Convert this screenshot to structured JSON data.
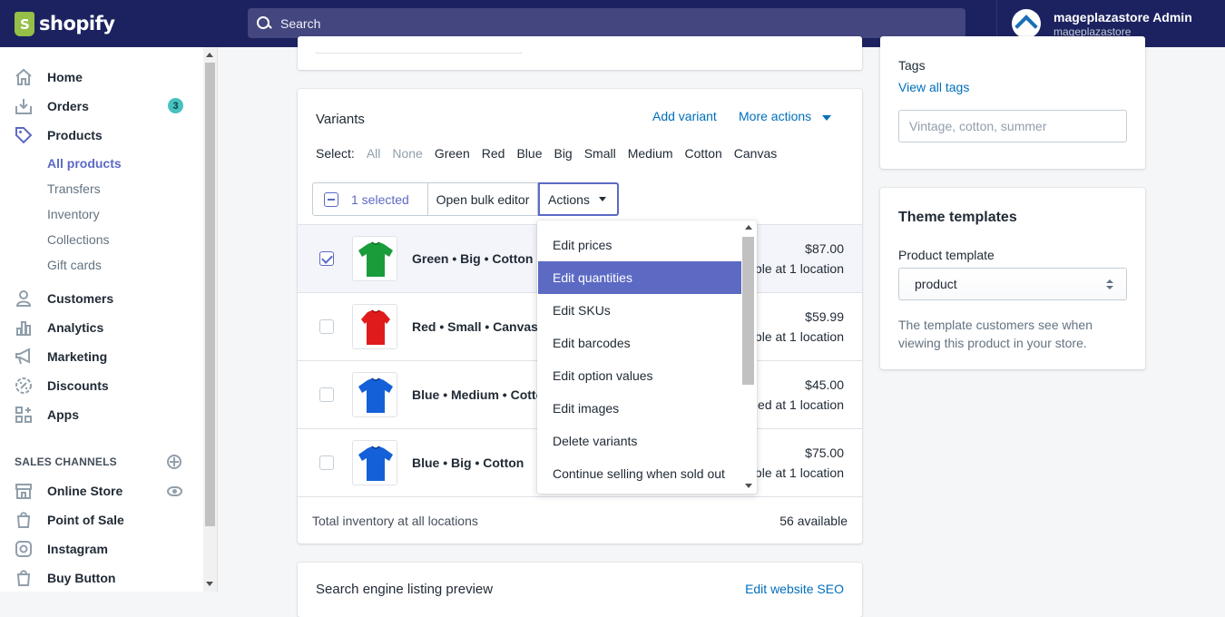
{
  "brand": {
    "name": "shopify",
    "color": "#95bf47",
    "topbar_color": "#1c2260"
  },
  "search": {
    "placeholder": "Search"
  },
  "user": {
    "name": "mageplazastore Admin",
    "store": "mageplazastore"
  },
  "sidebar": {
    "items": [
      {
        "label": "Home",
        "icon": "home-icon"
      },
      {
        "label": "Orders",
        "icon": "orders-icon",
        "badge": "3"
      },
      {
        "label": "Products",
        "icon": "tag-icon"
      },
      {
        "label": "Customers",
        "icon": "customer-icon"
      },
      {
        "label": "Analytics",
        "icon": "analytics-icon"
      },
      {
        "label": "Marketing",
        "icon": "megaphone-icon"
      },
      {
        "label": "Discounts",
        "icon": "discount-icon"
      },
      {
        "label": "Apps",
        "icon": "apps-icon"
      }
    ],
    "product_subitems": [
      "All products",
      "Transfers",
      "Inventory",
      "Collections",
      "Gift cards"
    ],
    "sales_channels_title": "SALES CHANNELS",
    "channels": [
      {
        "label": "Online Store",
        "icon": "store-icon"
      },
      {
        "label": "Point of Sale",
        "icon": "shopping-bag-icon"
      },
      {
        "label": "Instagram",
        "icon": "instagram-icon"
      },
      {
        "label": "Buy Button",
        "icon": "buy-button-icon"
      }
    ]
  },
  "variants": {
    "title": "Variants",
    "add_variant": "Add variant",
    "more_actions": "More actions",
    "select_label": "Select:",
    "select_options": [
      "All",
      "None",
      "Green",
      "Red",
      "Blue",
      "Big",
      "Small",
      "Medium",
      "Cotton",
      "Canvas"
    ],
    "bulk": {
      "selected": "1 selected",
      "open_bulk_editor": "Open bulk editor",
      "actions": "Actions"
    },
    "rows": [
      {
        "name": "Green • Big • Cotton",
        "price": "$87.00",
        "stock": "ble at 1 location",
        "color": "#1a9c3a",
        "checked": true
      },
      {
        "name": "Red • Small • Canvas",
        "price": "$59.99",
        "stock": "ble at 1 location",
        "color": "#e01b1b",
        "checked": false
      },
      {
        "name": "Blue • Medium • Cotto",
        "price": "$45.00",
        "stock": "ed at 1 location",
        "color": "#1460d8",
        "checked": false
      },
      {
        "name": "Blue • Big • Cotton",
        "price": "$75.00",
        "stock": "ble at 1 location",
        "color": "#1460d8",
        "checked": false
      }
    ],
    "total_label": "Total inventory at all locations",
    "total_value": "56 available"
  },
  "actions_menu": {
    "items": [
      "Edit prices",
      "Edit quantities",
      "Edit SKUs",
      "Edit barcodes",
      "Edit option values",
      "Edit images",
      "Delete variants",
      "Continue selling when sold out"
    ],
    "highlighted": "Edit quantities"
  },
  "seo": {
    "title": "Search engine listing preview",
    "edit_link": "Edit website SEO"
  },
  "tags": {
    "title": "Tags",
    "view_all": "View all tags",
    "placeholder": "Vintage, cotton, summer"
  },
  "theme": {
    "title": "Theme templates",
    "label": "Product template",
    "value": "product",
    "help": "The template customers see when viewing this product in your store."
  },
  "colors": {
    "accent": "#5c6ac4",
    "link": "#006fbb"
  }
}
